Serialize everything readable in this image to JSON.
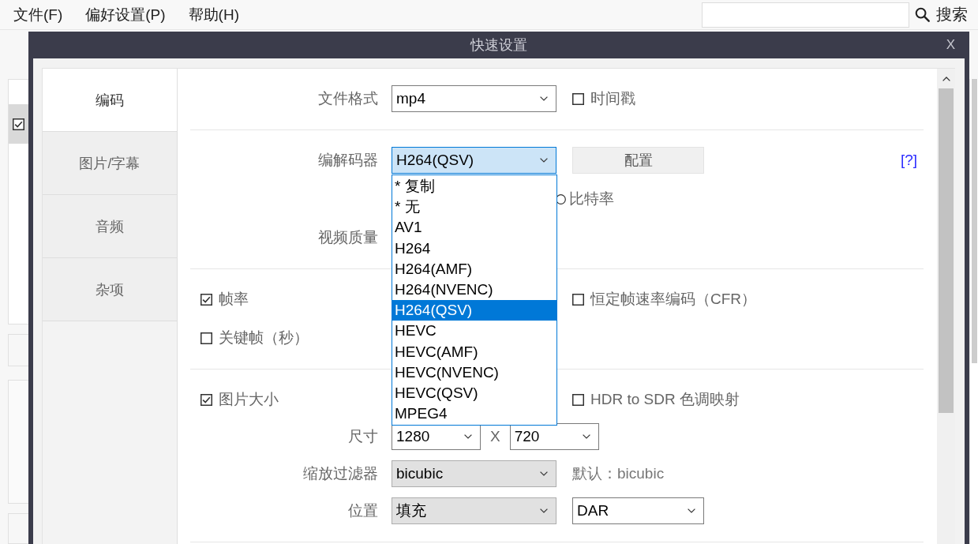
{
  "menu_bar": {
    "items": [
      {
        "label": "文件(F)"
      },
      {
        "label": "偏好设置(P)"
      },
      {
        "label": "帮助(H)"
      }
    ],
    "search_button": "搜索"
  },
  "background_list": {
    "rows": [
      {
        "checked": true,
        "selected": true
      }
    ]
  },
  "dialog": {
    "title": "快速设置",
    "close": "X",
    "tabs": [
      {
        "label": "编码",
        "selected": true
      },
      {
        "label": "图片/字幕",
        "selected": false
      },
      {
        "label": "音频",
        "selected": false
      },
      {
        "label": "杂项",
        "selected": false
      }
    ],
    "sections": [
      {
        "rows": [
          {
            "label": "文件格式",
            "main": {
              "kind": "select",
              "value": "mp4",
              "editable": true
            },
            "side": [
              {
                "kind": "checkbox",
                "label": "时间戳",
                "checked": false
              }
            ]
          }
        ]
      },
      {
        "rows": [
          {
            "label": "编解码器",
            "main": {
              "kind": "select",
              "value": "H264(QSV)",
              "open": true,
              "options": [
                {
                  "label": "* 复制",
                  "selected": false
                },
                {
                  "label": "* 无",
                  "selected": false
                },
                {
                  "label": "AV1",
                  "selected": false
                },
                {
                  "label": "H264",
                  "selected": false
                },
                {
                  "label": "H264(AMF)",
                  "selected": false
                },
                {
                  "label": "H264(NVENC)",
                  "selected": false
                },
                {
                  "label": "H264(QSV)",
                  "selected": true
                },
                {
                  "label": "HEVC",
                  "selected": false
                },
                {
                  "label": "HEVC(AMF)",
                  "selected": false
                },
                {
                  "label": "HEVC(NVENC)",
                  "selected": false
                },
                {
                  "label": "HEVC(QSV)",
                  "selected": false
                },
                {
                  "label": "MPEG4",
                  "selected": false
                }
              ]
            },
            "side": [
              {
                "kind": "button",
                "label": "配置"
              },
              {
                "kind": "help",
                "label": "[?]"
              }
            ]
          },
          {
            "side": [
              {
                "kind": "radio",
                "label": "比特率",
                "selected": false
              }
            ]
          },
          {
            "label": "视频质量"
          }
        ]
      },
      {
        "rows": [
          {
            "toggle": {
              "label": "帧率",
              "checked": true
            },
            "side": [
              {
                "kind": "checkbox",
                "label": "恒定帧速率编码（CFR）",
                "checked": false
              }
            ]
          },
          {
            "toggle": {
              "label": "关键帧（秒）",
              "checked": false
            }
          }
        ]
      },
      {
        "rows": [
          {
            "toggle": {
              "label": "图片大小",
              "checked": true
            },
            "side": [
              {
                "kind": "checkbox",
                "label": "HDR to SDR 色调映射",
                "checked": false
              }
            ]
          },
          {
            "label": "尺寸",
            "main": {
              "kind": "dimensions",
              "separator": "X",
              "fields": [
                {
                  "value": "1280",
                  "editable": true
                },
                {
                  "value": "720",
                  "editable": true
                }
              ]
            }
          },
          {
            "label": "缩放过滤器",
            "main": {
              "kind": "select",
              "value": "bicubic",
              "editable": false
            },
            "side": [
              {
                "kind": "note",
                "text": "默认：bicubic"
              }
            ]
          },
          {
            "label": "位置",
            "main": {
              "kind": "select",
              "value": "填充",
              "editable": false
            },
            "side": [
              {
                "kind": "select",
                "value": "DAR",
                "editable": true
              }
            ]
          }
        ]
      }
    ]
  }
}
